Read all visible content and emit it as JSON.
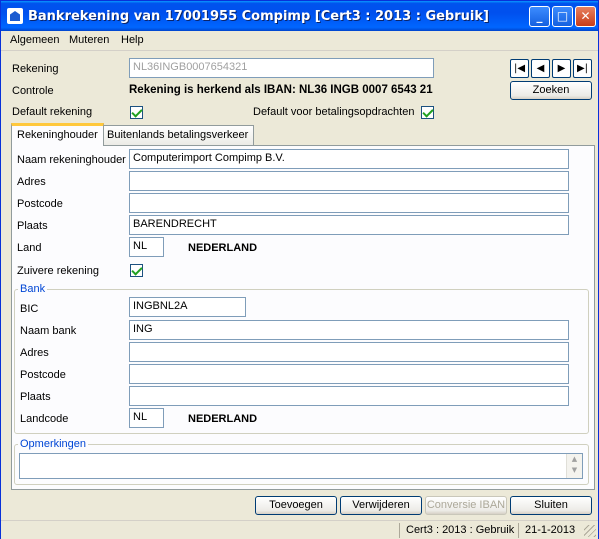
{
  "window": {
    "title": "Bankrekening van 17001955 Compimp  [Cert3 : 2013 : Gebruik]",
    "minimize": "_",
    "maximize": "□",
    "close": "✕"
  },
  "menu": [
    "Algemeen",
    "Muteren",
    "Help"
  ],
  "header": {
    "rekening_label": "Rekening",
    "rekening_value": "NL36INGB0007654321",
    "controle_label": "Controle",
    "controle_value": "Rekening is herkend als IBAN: NL36 INGB 0007 6543 21",
    "default_label": "Default rekening",
    "default_checked": true,
    "default_betaling_label": "Default voor betalingsopdrachten",
    "default_betaling_checked": true,
    "nav_first": "|◀",
    "nav_prev": "◀",
    "nav_next": "▶",
    "nav_last": "▶|",
    "zoeken": "Zoeken"
  },
  "tabs": [
    "Rekeninghouder",
    "Buitenlands betalingsverkeer"
  ],
  "holder": {
    "naam_label": "Naam rekeninghouder",
    "naam_value": "Computerimport Compimp B.V.",
    "adres_label": "Adres",
    "adres_value": "",
    "postcode_label": "Postcode",
    "postcode_value": "",
    "plaats_label": "Plaats",
    "plaats_value": "BARENDRECHT",
    "land_label": "Land",
    "land_code": "NL",
    "land_name": "NEDERLAND",
    "zuivere_label": "Zuivere rekening",
    "zuivere_checked": true
  },
  "bank": {
    "group_title": "Bank",
    "bic_label": "BIC",
    "bic_value": "INGBNL2A",
    "naam_label": "Naam bank",
    "naam_value": "ING",
    "adres_label": "Adres",
    "adres_value": "",
    "postcode_label": "Postcode",
    "postcode_value": "",
    "plaats_label": "Plaats",
    "plaats_value": "",
    "landcode_label": "Landcode",
    "landcode_value": "NL",
    "landcode_name": "NEDERLAND"
  },
  "opmerkingen": {
    "group_title": "Opmerkingen",
    "value": ""
  },
  "buttons": {
    "toevoegen": "Toevoegen",
    "verwijderen": "Verwijderen",
    "conversie": "Conversie IBAN",
    "sluiten": "Sluiten"
  },
  "status": {
    "context": "Cert3 : 2013 : Gebruik",
    "date": "21-1-2013"
  }
}
